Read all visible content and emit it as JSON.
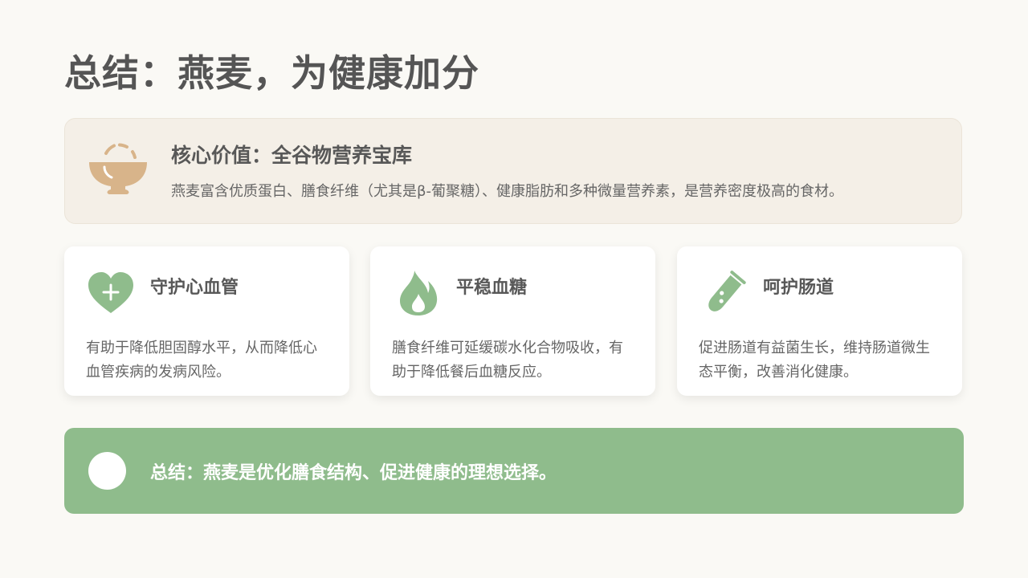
{
  "title": "总结：燕麦，为健康加分",
  "core": {
    "icon": "rice-bowl-icon",
    "title": "核心价值：全谷物营养宝库",
    "description": "燕麦富含优质蛋白、膳食纤维（尤其是β-葡聚糖）、健康脂肪和多种微量营养素，是营养密度极高的食材。"
  },
  "features": [
    {
      "icon": "heart-plus-icon",
      "title": "守护心血管",
      "description": "有助于降低胆固醇水平，从而降低心血管疾病的发病风险。"
    },
    {
      "icon": "flame-icon",
      "title": "平稳血糖",
      "description": "膳食纤维可延缓碳水化合物吸收，有助于降低餐后血糖反应。"
    },
    {
      "icon": "test-tube-icon",
      "title": "呵护肠道",
      "description": "促进肠道有益菌生长，维持肠道微生态平衡，改善消化健康。"
    }
  ],
  "summary": {
    "icon": "circle-icon",
    "text": "总结：燕麦是优化膳食结构、促进健康的理想选择。"
  },
  "colors": {
    "background": "#faf9f5",
    "core_card": "#f4efe7",
    "accent_tan": "#d8b48a",
    "accent_green": "#8fbc8c",
    "text_dark": "#555555"
  }
}
